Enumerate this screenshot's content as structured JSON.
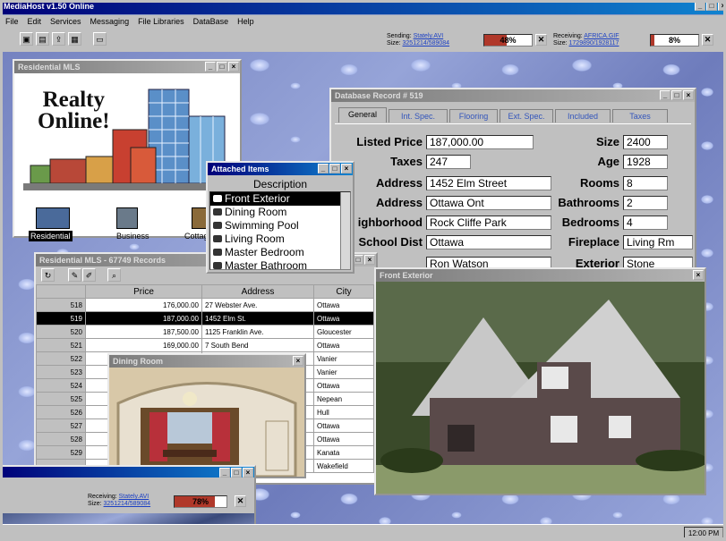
{
  "app": {
    "title": "MediaHost v1.50 Online",
    "menu": [
      "File",
      "Edit",
      "Services",
      "Messaging",
      "File Libraries",
      "DataBase",
      "Help"
    ],
    "sending_label": "Sending:",
    "sending_value": "Stately.AVI",
    "sending_size_label": "Size:",
    "sending_size": "3251214/589084",
    "sending_progress_text": "48%",
    "sending_progress": 0.48,
    "receiving_label": "Receiving:",
    "receiving_value": "AFRICA.GIF",
    "receiving_size_label": "Size:",
    "receiving_size": "1729890/1928117",
    "receiving_progress_text": "8%",
    "receiving_progress": 0.08,
    "clock": "12:00 PM"
  },
  "residential_window": {
    "title": "Residential MLS",
    "logo_line1": "Realty",
    "logo_line2": "Online!",
    "categories": [
      "Residential",
      "Business",
      "Cottage"
    ]
  },
  "db_record": {
    "title": "Database Record # 519",
    "tabs": [
      "General",
      "Int. Spec.",
      "Flooring",
      "Ext. Spec.",
      "Included",
      "Taxes"
    ],
    "left": [
      {
        "label": "Listed Price",
        "value": "187,000.00"
      },
      {
        "label": "Taxes",
        "value": "247"
      },
      {
        "label": "Address",
        "value": "1452 Elm Street"
      },
      {
        "label": "Address",
        "value": "Ottawa Ont"
      },
      {
        "label": "ighborhood",
        "value": "Rock Cliffe Park"
      },
      {
        "label": "School Dist",
        "value": "Ottawa"
      },
      {
        "label": "",
        "value": "Ron Watson"
      }
    ],
    "right": [
      {
        "label": "Size",
        "value": "2400"
      },
      {
        "label": "Age",
        "value": "1928"
      },
      {
        "label": "Rooms",
        "value": "8"
      },
      {
        "label": "Bathrooms",
        "value": "2"
      },
      {
        "label": "Bedrooms",
        "value": "4"
      },
      {
        "label": "Fireplace",
        "value": "Living Rm"
      },
      {
        "label": "Exterior",
        "value": "Stone"
      }
    ]
  },
  "attached_items": {
    "title": "Attached Items",
    "header": "Description",
    "items": [
      "Front Exterior",
      "Dining Room",
      "Swimming Pool",
      "Living Room",
      "Master Bedroom",
      "Master Bathroom"
    ],
    "selected": "Front Exterior"
  },
  "records_window": {
    "title": "Residential MLS - 67749 Records",
    "columns": [
      "",
      "Price",
      "Address",
      "City"
    ],
    "rows": [
      {
        "num": "518",
        "price": "176,000.00",
        "address": "27 Webster Ave.",
        "city": "Ottawa"
      },
      {
        "num": "519",
        "price": "187,000.00",
        "address": "1452 Elm St.",
        "city": "Ottawa"
      },
      {
        "num": "520",
        "price": "187,500.00",
        "address": "1125 Franklin Ave.",
        "city": "Gloucester"
      },
      {
        "num": "521",
        "price": "169,000.00",
        "address": "7 South Bend",
        "city": "Ottawa"
      },
      {
        "num": "522",
        "price": "",
        "address": "",
        "city": "Vanier"
      },
      {
        "num": "523",
        "price": "",
        "address": "",
        "city": "Vanier"
      },
      {
        "num": "524",
        "price": "",
        "address": "",
        "city": "Ottawa"
      },
      {
        "num": "525",
        "price": "",
        "address": "",
        "city": "Nepean"
      },
      {
        "num": "526",
        "price": "",
        "address": "",
        "city": "Hull"
      },
      {
        "num": "527",
        "price": "",
        "address": "",
        "city": "Ottawa"
      },
      {
        "num": "528",
        "price": "",
        "address": "",
        "city": "Ottawa"
      },
      {
        "num": "529",
        "price": "",
        "address": "",
        "city": "Kanata"
      },
      {
        "num": "",
        "price": "",
        "address": "",
        "city": "Wakefield"
      }
    ]
  },
  "dining_window": {
    "title": "Dining Room"
  },
  "exterior_window": {
    "title": "Front Exterior"
  },
  "receiving_window": {
    "receiving_label": "Receiving:",
    "receiving_value": "Stately.AVI",
    "size_label": "Size:",
    "size_value": "3251214/589084",
    "progress_text": "78%",
    "progress": 0.78
  },
  "colors": {
    "titlebar": "#000078",
    "progress": "#b0382a",
    "link": "#1a3fc4"
  }
}
